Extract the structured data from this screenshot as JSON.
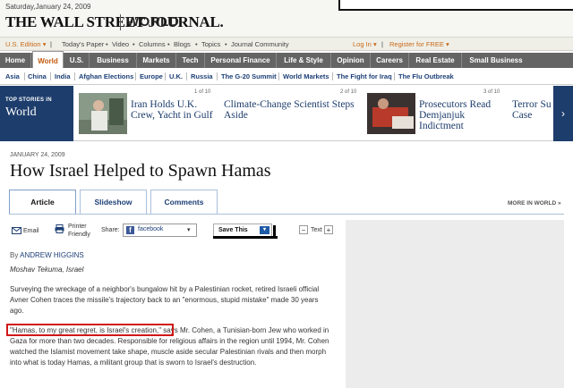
{
  "masthead": {
    "date": "Saturday,January 24, 2009",
    "logo": "THE WALL STREET JOURNAL.",
    "section": "WORLD"
  },
  "utility": {
    "edition": "U.S. Edition",
    "edition_arrow": "▾",
    "links": [
      "Today's Paper",
      "Video",
      "Columns",
      "Blogs",
      "Topics",
      "Journal Community"
    ],
    "separator": "•",
    "login": "Log In",
    "register": "Register for FREE",
    "arrow": "▾"
  },
  "nav": {
    "items": [
      "Home",
      "World",
      "U.S.",
      "Business",
      "Markets",
      "Tech",
      "Personal Finance",
      "Life & Style",
      "Opinion",
      "Careers",
      "Real Estate",
      "Small Business"
    ],
    "active": "World"
  },
  "subnav": {
    "items": [
      "Asia",
      "China",
      "India",
      "Afghan Elections",
      "Europe",
      "U.K.",
      "Russia",
      "The G-20 Summit",
      "World Markets",
      "The Fight for Iraq",
      "The Flu Outbreak"
    ]
  },
  "top_stories": {
    "label_small": "TOP STORIES IN",
    "label_big": "World",
    "stories": [
      {
        "count": "1 of 10",
        "title_line1": "Iran Holds U.K.",
        "title_line2": "Crew, Yacht in Gulf"
      },
      {
        "count": "2 of 10",
        "title_line1": "Climate-Change Scientist Steps",
        "title_line2": "Aside"
      },
      {
        "count": "3 of 10",
        "title_line1": "Prosecutors Read",
        "title_line2": "Demjanjuk",
        "title_line3": "Indictment"
      },
      {
        "count": "",
        "title_line1": "Terror Su",
        "title_line2": "Case"
      }
    ],
    "next_arrow": "›"
  },
  "article": {
    "date": "JANUARY 24, 2009",
    "headline": "How Israel Helped to Spawn Hamas",
    "tabs": [
      "Article",
      "Slideshow",
      "Comments"
    ],
    "more_in_world": "MORE IN WORLD »",
    "tools": {
      "email": "Email",
      "printer_line1": "Printer",
      "printer_line2": "Friendly",
      "share_label": "Share:",
      "share_value": "facebook",
      "share_arrow": "▾",
      "save_this": "Save This",
      "save_btn": "▾",
      "text_minus": "−",
      "text_label": "Text",
      "text_plus": "+"
    },
    "byline_prefix": "By",
    "byline_name": "ANDREW HIGGINS",
    "dateline": "Moshav Tekuma, Israel",
    "para1": "Surveying the wreckage of a neighbor's bungalow hit by a Palestinian rocket, retired Israeli official Avner Cohen traces the missile's trajectory back to an \"enormous, stupid mistake\" made 30 years ago.",
    "para2_quote": "\"Hamas, to my great regret, is Israel's creation,\"",
    "para2_rest": " says Mr. Cohen, a Tunisian-born Jew who worked in Gaza for more than two decades. Responsible for religious affairs in the region until 1994, Mr. Cohen watched the Islamist movement take shape, muscle aside secular Palestinian rivals and then morph into what is today Hamas, a militant group that is sworn to Israel's destruction."
  },
  "colors": {
    "brand_navy": "#1d3d6c",
    "nav_gray": "#646464",
    "link_blue": "#1c3f76",
    "accent_orange": "#c86a1a",
    "highlight_red": "#d01818"
  }
}
